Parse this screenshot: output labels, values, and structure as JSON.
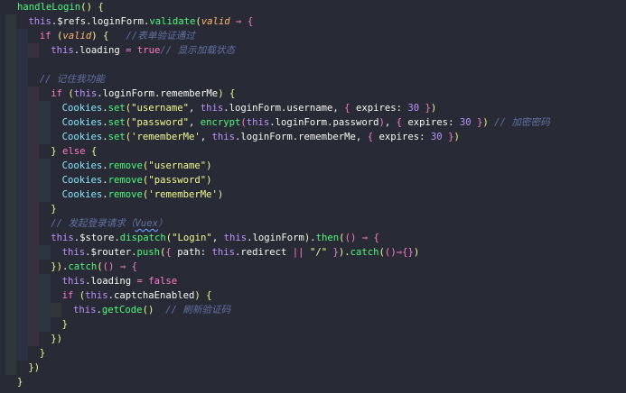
{
  "editor": {
    "background": "#282a36",
    "lines": [
      "handleLogin() {",
      "this.$refs.loginForm.validate(valid ⇒ {",
      "if (valid) {   //表单验证通过",
      "this.loading = true// 显示加载状态",
      "",
      "// 记住我功能",
      "if (this.loginForm.rememberMe) {",
      "Cookies.set(\"username\", this.loginForm.username, { expires: 30 })",
      "Cookies.set(\"password\", encrypt(this.loginForm.password), { expires: 30 }) // 加密密码",
      "Cookies.set('rememberMe', this.loginForm.rememberMe, { expires: 30 })",
      "} else {",
      "Cookies.remove(\"username\")",
      "Cookies.remove(\"password\")",
      "Cookies.remove('rememberMe')",
      "}",
      "// 发起登录请求（Vuex）",
      "this.$store.dispatch(\"Login\", this.loginForm).then(() ⇒ {",
      "this.$router.push({ path: this.redirect || \"/\" }).catch(()⇒{})",
      "}).catch(() ⇒ {",
      "this.loading = false",
      "if (this.captchaEnabled) {",
      "this.getCode()  // 刷新验证码",
      "}",
      "})",
      "}",
      "})",
      "}"
    ]
  }
}
